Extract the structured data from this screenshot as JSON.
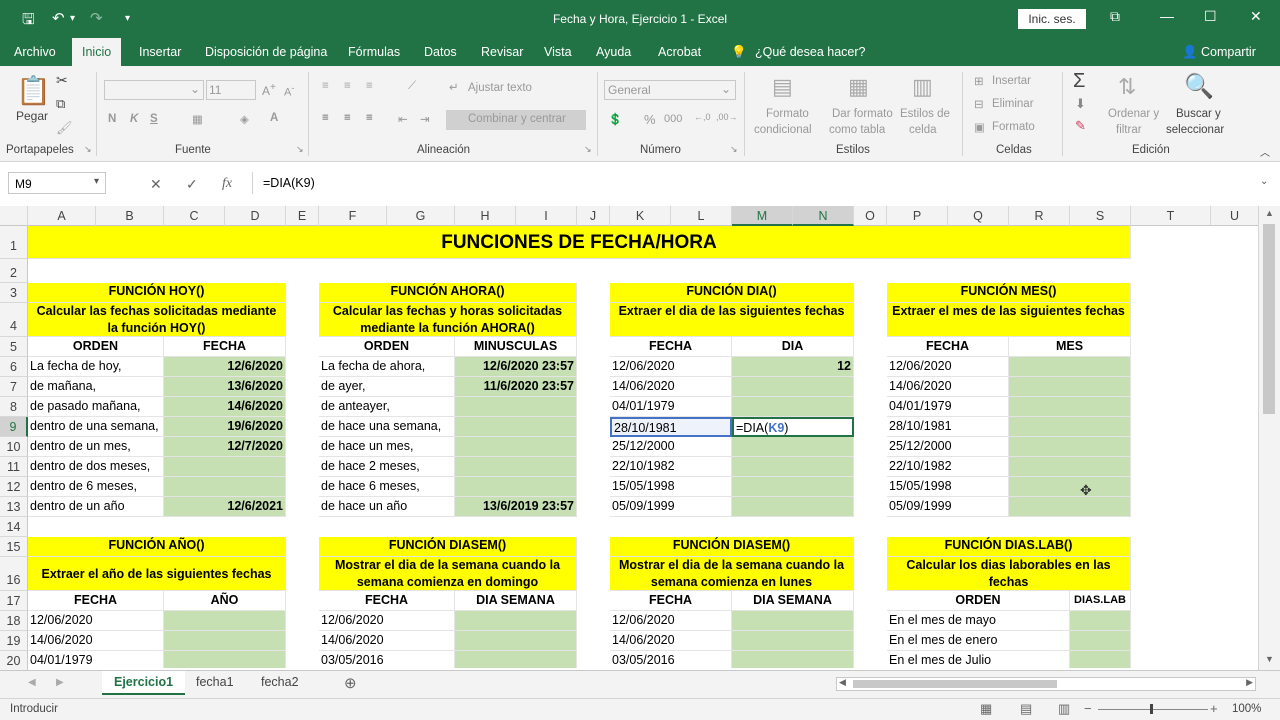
{
  "window": {
    "title": "Fecha y Hora, Ejercicio 1  -  Excel",
    "signin": "Inic. ses.",
    "share": "Compartir"
  },
  "tabs": [
    "Archivo",
    "Inicio",
    "Insertar",
    "Disposición de página",
    "Fórmulas",
    "Datos",
    "Revisar",
    "Vista",
    "Ayuda",
    "Acrobat",
    "¿Qué desea hacer?"
  ],
  "ribbon": {
    "paste": "Pegar",
    "group_clipboard": "Portapapeles",
    "font_size": "11",
    "bold": "N",
    "italic": "K",
    "underline": "S",
    "group_font": "Fuente",
    "wrap": "Ajustar texto",
    "merge": "Combinar y centrar",
    "group_align": "Alineación",
    "numfmt": "General",
    "group_number": "Número",
    "cond1": "Formato",
    "cond2": "condicional",
    "table1": "Dar formato",
    "table2": "como tabla",
    "styles1": "Estilos de",
    "styles2": "celda",
    "group_styles": "Estilos",
    "insert": "Insertar",
    "delete": "Eliminar",
    "format": "Formato",
    "group_cells": "Celdas",
    "sort1": "Ordenar y",
    "sort2": "filtrar",
    "find1": "Buscar y",
    "find2": "seleccionar",
    "group_edit": "Edición"
  },
  "formula_bar": {
    "name_box": "M9",
    "formula": "=DIA(K9)"
  },
  "columns": [
    "A",
    "B",
    "C",
    "D",
    "E",
    "F",
    "G",
    "H",
    "I",
    "J",
    "K",
    "L",
    "M",
    "N",
    "O",
    "P",
    "Q",
    "R",
    "S",
    "T",
    "U"
  ],
  "rows": [
    "1",
    "2",
    "3",
    "4",
    "5",
    "6",
    "7",
    "8",
    "9",
    "10",
    "11",
    "12",
    "13",
    "14",
    "15",
    "16",
    "17",
    "18",
    "19",
    "20"
  ],
  "sheet": {
    "title": "FUNCIONES DE FECHA/HORA",
    "hoy": {
      "t1": "FUNCIÓN HOY()",
      "t2": "Calcular las fechas solicitadas mediante la función HOY()",
      "h1": "ORDEN",
      "h2": "FECHA",
      "rows": [
        [
          "La fecha de hoy,",
          "12/6/2020"
        ],
        [
          "de mañana,",
          "13/6/2020"
        ],
        [
          "de pasado mañana,",
          "14/6/2020"
        ],
        [
          "dentro de una semana,",
          "19/6/2020"
        ],
        [
          "dentro de un mes,",
          "12/7/2020"
        ],
        [
          "dentro de dos meses,",
          ""
        ],
        [
          "dentro de 6 meses,",
          ""
        ],
        [
          "dentro de un año",
          "12/6/2021"
        ]
      ]
    },
    "ahora": {
      "t1": "FUNCIÓN AHORA()",
      "t2": "Calcular las fechas y horas solicitadas mediante la función AHORA()",
      "h1": "ORDEN",
      "h2": "MINUSCULAS",
      "rows": [
        [
          "La fecha de ahora,",
          "12/6/2020 23:57"
        ],
        [
          "de ayer,",
          "11/6/2020 23:57"
        ],
        [
          "de anteayer,",
          ""
        ],
        [
          "de hace una semana,",
          ""
        ],
        [
          "de hace un mes,",
          ""
        ],
        [
          "de hace 2 meses,",
          ""
        ],
        [
          "de hace 6 meses,",
          ""
        ],
        [
          "de hace un año",
          "13/6/2019 23:57"
        ]
      ]
    },
    "dia": {
      "t1": "FUNCIÓN DIA()",
      "t2": "Extraer el dia de las siguientes fechas",
      "h1": "FECHA",
      "h2": "DIA",
      "rows": [
        [
          "12/06/2020",
          "12"
        ],
        [
          "14/06/2020",
          ""
        ],
        [
          "04/01/1979",
          ""
        ],
        [
          "28/10/1981",
          "=DIA(K9)"
        ],
        [
          "25/12/2000",
          ""
        ],
        [
          "22/10/1982",
          ""
        ],
        [
          "15/05/1998",
          ""
        ],
        [
          "05/09/1999",
          ""
        ]
      ]
    },
    "mes": {
      "t1": "FUNCIÓN MES()",
      "t2": "Extraer el mes de las siguientes fechas",
      "h1": "FECHA",
      "h2": "MES",
      "rows": [
        [
          "12/06/2020",
          ""
        ],
        [
          "14/06/2020",
          ""
        ],
        [
          "04/01/1979",
          ""
        ],
        [
          "28/10/1981",
          ""
        ],
        [
          "25/12/2000",
          ""
        ],
        [
          "22/10/1982",
          ""
        ],
        [
          "15/05/1998",
          ""
        ],
        [
          "05/09/1999",
          ""
        ]
      ]
    },
    "ano": {
      "t1": "FUNCIÓN AÑO()",
      "t2": "Extraer el año de las siguientes fechas",
      "h1": "FECHA",
      "h2": "AÑO",
      "rows": [
        [
          "12/06/2020",
          ""
        ],
        [
          "14/06/2020",
          ""
        ],
        [
          "04/01/1979",
          ""
        ]
      ]
    },
    "diasem1": {
      "t1": "FUNCIÓN DIASEM()",
      "t2": "Mostrar el dia de la semana cuando la semana comienza en domingo",
      "h1": "FECHA",
      "h2": "DIA SEMANA",
      "rows": [
        [
          "12/06/2020",
          ""
        ],
        [
          "14/06/2020",
          ""
        ],
        [
          "03/05/2016",
          ""
        ]
      ]
    },
    "diasem2": {
      "t1": "FUNCIÓN DIASEM()",
      "t2": "Mostrar el dia de la semana cuando la semana comienza en lunes",
      "h1": "FECHA",
      "h2": "DIA SEMANA",
      "rows": [
        [
          "12/06/2020",
          ""
        ],
        [
          "14/06/2020",
          ""
        ],
        [
          "03/05/2016",
          ""
        ]
      ]
    },
    "diaslab": {
      "t1": "FUNCIÓN DIAS.LAB()",
      "t2": "Calcular los dias laborables en las fechas",
      "h1": "ORDEN",
      "h2": "DIAS.LAB",
      "rows": [
        [
          "En el mes de mayo",
          ""
        ],
        [
          "En el mes de enero",
          ""
        ],
        [
          "En el mes de Julio",
          ""
        ]
      ]
    }
  },
  "sheet_tabs": [
    "Ejercicio1",
    "fecha1",
    "fecha2"
  ],
  "status": {
    "mode": "Introducir",
    "zoom": "100%"
  },
  "colors": {
    "excel_green": "#217346",
    "yellow": "#ffff00",
    "cell_green": "#c6e0b4"
  }
}
